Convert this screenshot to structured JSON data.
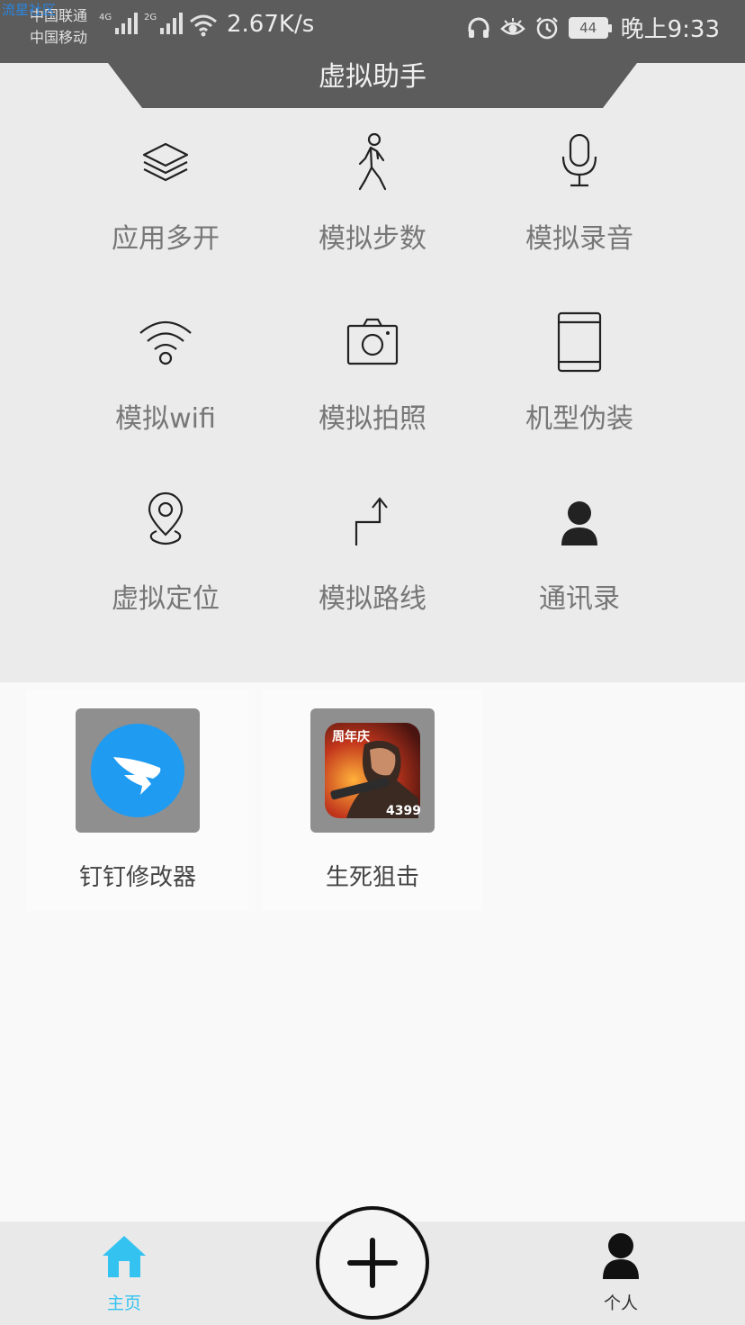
{
  "status_bar": {
    "watermark": "流星社区",
    "carrier_1": "中国联通",
    "carrier_2": "中国移动",
    "signal_1_tag": "4G",
    "signal_2_tag": "2G",
    "net_speed": "2.67K/s",
    "battery": "44",
    "time": "晚上9:33",
    "icons": [
      "headphones-icon",
      "eye-icon",
      "alarm-icon",
      "wifi-icon"
    ]
  },
  "header": {
    "title": "虚拟助手"
  },
  "tools": [
    {
      "label": "应用多开",
      "icon": "layers-icon"
    },
    {
      "label": "模拟步数",
      "icon": "walking-icon"
    },
    {
      "label": "模拟录音",
      "icon": "microphone-icon"
    },
    {
      "label": "模拟wifi",
      "icon": "wifi-icon"
    },
    {
      "label": "模拟拍照",
      "icon": "camera-icon"
    },
    {
      "label": "机型伪装",
      "icon": "phone-icon"
    },
    {
      "label": "虚拟定位",
      "icon": "location-pin-icon"
    },
    {
      "label": "模拟路线",
      "icon": "route-arrow-icon"
    },
    {
      "label": "通讯录",
      "icon": "contact-person-icon"
    }
  ],
  "apps": [
    {
      "name": "钉钉修改器",
      "icon": "dingtalk-icon",
      "color": "#1f9bf2"
    },
    {
      "name": "生死狙击",
      "icon": "game-icon",
      "badge": "周年庆",
      "badge2": "4399"
    }
  ],
  "bottom_nav": {
    "home_label": "主页",
    "profile_label": "个人",
    "active_color": "#34c3f0"
  }
}
